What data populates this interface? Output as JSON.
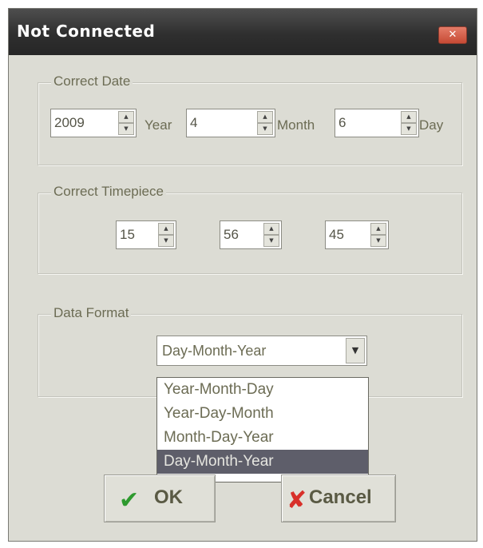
{
  "window": {
    "title": "Not Connected",
    "close_icon": "close-icon"
  },
  "correct_date": {
    "label": "Correct Date",
    "year_value": "2009",
    "year_unit": "Year",
    "month_value": "4",
    "month_unit": "Month",
    "day_value": "6",
    "day_unit": "Day"
  },
  "correct_timepiece": {
    "label": "Correct Timepiece",
    "hour_value": "15",
    "minute_value": "56",
    "second_value": "45"
  },
  "data_format": {
    "label": "Data Format",
    "selected": "Day-Month-Year",
    "options": [
      "Year-Month-Day",
      "Year-Day-Month",
      "Month-Day-Year",
      "Day-Month-Year"
    ]
  },
  "buttons": {
    "ok_label": "OK",
    "cancel_label": "Cancel"
  },
  "colors": {
    "ok_check": "#2e9a2e",
    "cancel_x": "#d8302a",
    "selected_option_bg": "#5e5e6a"
  }
}
